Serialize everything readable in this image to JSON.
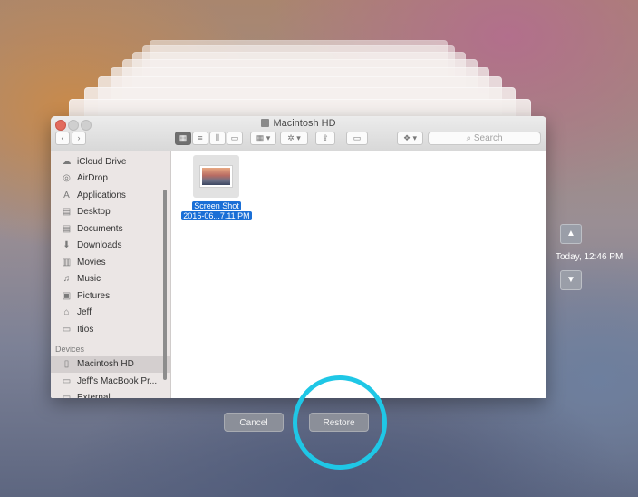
{
  "window": {
    "title": "Macintosh HD",
    "search_placeholder": "Search"
  },
  "toolbar": {
    "back_icon": "chevron-left-icon",
    "forward_icon": "chevron-right-icon"
  },
  "sidebar": {
    "favorites": [
      {
        "label": "iCloud Drive",
        "icon": "cloud-icon"
      },
      {
        "label": "AirDrop",
        "icon": "airdrop-icon"
      },
      {
        "label": "Applications",
        "icon": "applications-icon"
      },
      {
        "label": "Desktop",
        "icon": "desktop-icon"
      },
      {
        "label": "Documents",
        "icon": "documents-icon"
      },
      {
        "label": "Downloads",
        "icon": "downloads-icon"
      },
      {
        "label": "Movies",
        "icon": "movies-icon"
      },
      {
        "label": "Music",
        "icon": "music-icon"
      },
      {
        "label": "Pictures",
        "icon": "pictures-icon"
      },
      {
        "label": "Jeff",
        "icon": "home-icon"
      },
      {
        "label": "Itios",
        "icon": "folder-icon"
      }
    ],
    "devices_heading": "Devices",
    "devices": [
      {
        "label": "Macintosh HD",
        "icon": "hard-disk-icon",
        "selected": true
      },
      {
        "label": "Jeff’s MacBook Pr...",
        "icon": "laptop-icon"
      },
      {
        "label": "External",
        "icon": "external-disk-icon"
      }
    ]
  },
  "content": {
    "file": {
      "name_line1": "Screen Shot",
      "name_line2": "2015-06...7.11 PM"
    }
  },
  "actions": {
    "cancel": "Cancel",
    "restore": "Restore"
  },
  "timeline": {
    "label": "Today, 12:46 PM"
  },
  "colors": {
    "highlight_ring": "#1fc7e6",
    "selection": "#1a6fd6"
  }
}
